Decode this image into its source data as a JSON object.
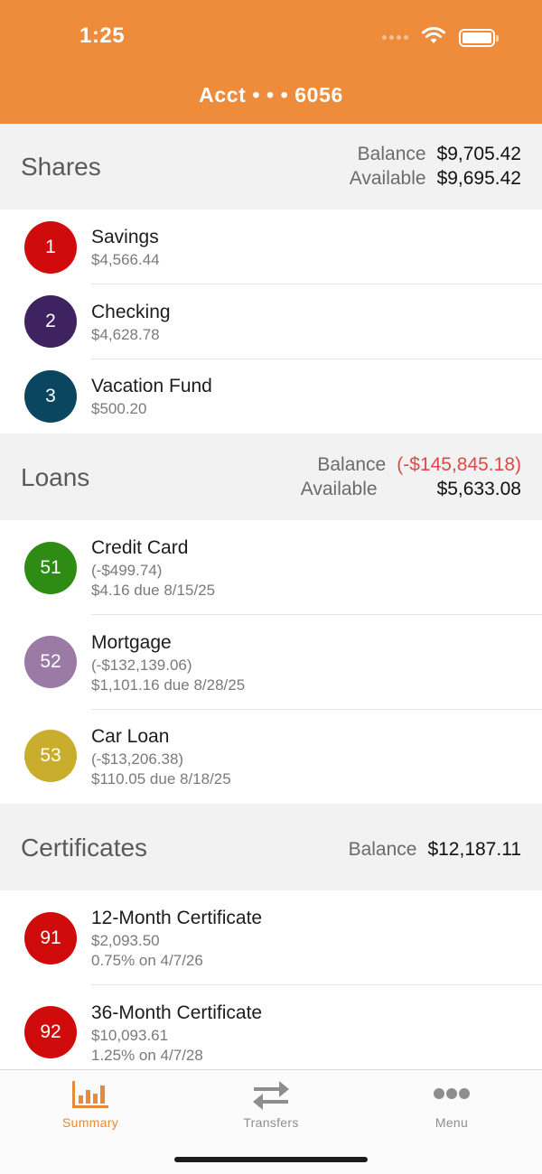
{
  "status": {
    "time": "1:25"
  },
  "header": {
    "title": "Acct  • • •  6056"
  },
  "shares": {
    "title": "Shares",
    "balance_label": "Balance",
    "balance_value": "$9,705.42",
    "available_label": "Available",
    "available_value": "$9,695.42",
    "items": [
      {
        "badge": "1",
        "color": "#D00B0B",
        "name": "Savings",
        "sub1": "$4,566.44"
      },
      {
        "badge": "2",
        "color": "#3F2260",
        "name": "Checking",
        "sub1": "$4,628.78"
      },
      {
        "badge": "3",
        "color": "#0B4660",
        "name": "Vacation Fund",
        "sub1": "$500.20"
      }
    ]
  },
  "loans": {
    "title": "Loans",
    "balance_label": "Balance",
    "balance_value": "(-$145,845.18)",
    "available_label": "Available",
    "available_value": "$5,633.08",
    "items": [
      {
        "badge": "51",
        "color": "#2E8B14",
        "name": "Credit Card",
        "sub1": "(-$499.74)",
        "sub2": "$4.16 due 8/15/25"
      },
      {
        "badge": "52",
        "color": "#9B7AA6",
        "name": "Mortgage",
        "sub1": "(-$132,139.06)",
        "sub2": "$1,101.16 due 8/28/25"
      },
      {
        "badge": "53",
        "color": "#C9AE2E",
        "name": "Car Loan",
        "sub1": "(-$13,206.38)",
        "sub2": "$110.05 due 8/18/25"
      }
    ]
  },
  "certificates": {
    "title": "Certificates",
    "balance_label": "Balance",
    "balance_value": "$12,187.11",
    "items": [
      {
        "badge": "91",
        "color": "#D00B0B",
        "name": "12-Month Certificate",
        "sub1": "$2,093.50",
        "sub2": "0.75% on 4/7/26"
      },
      {
        "badge": "92",
        "color": "#D00B0B",
        "name": "36-Month Certificate",
        "sub1": "$10,093.61",
        "sub2": "1.25% on 4/7/28"
      }
    ]
  },
  "tabbar": {
    "summary": "Summary",
    "transfers": "Transfers",
    "menu": "Menu",
    "active_color": "#E48A3A",
    "inactive_color": "#8E8E8E"
  },
  "colors": {
    "header": "#EE8C3B",
    "negative": "#E04848"
  }
}
